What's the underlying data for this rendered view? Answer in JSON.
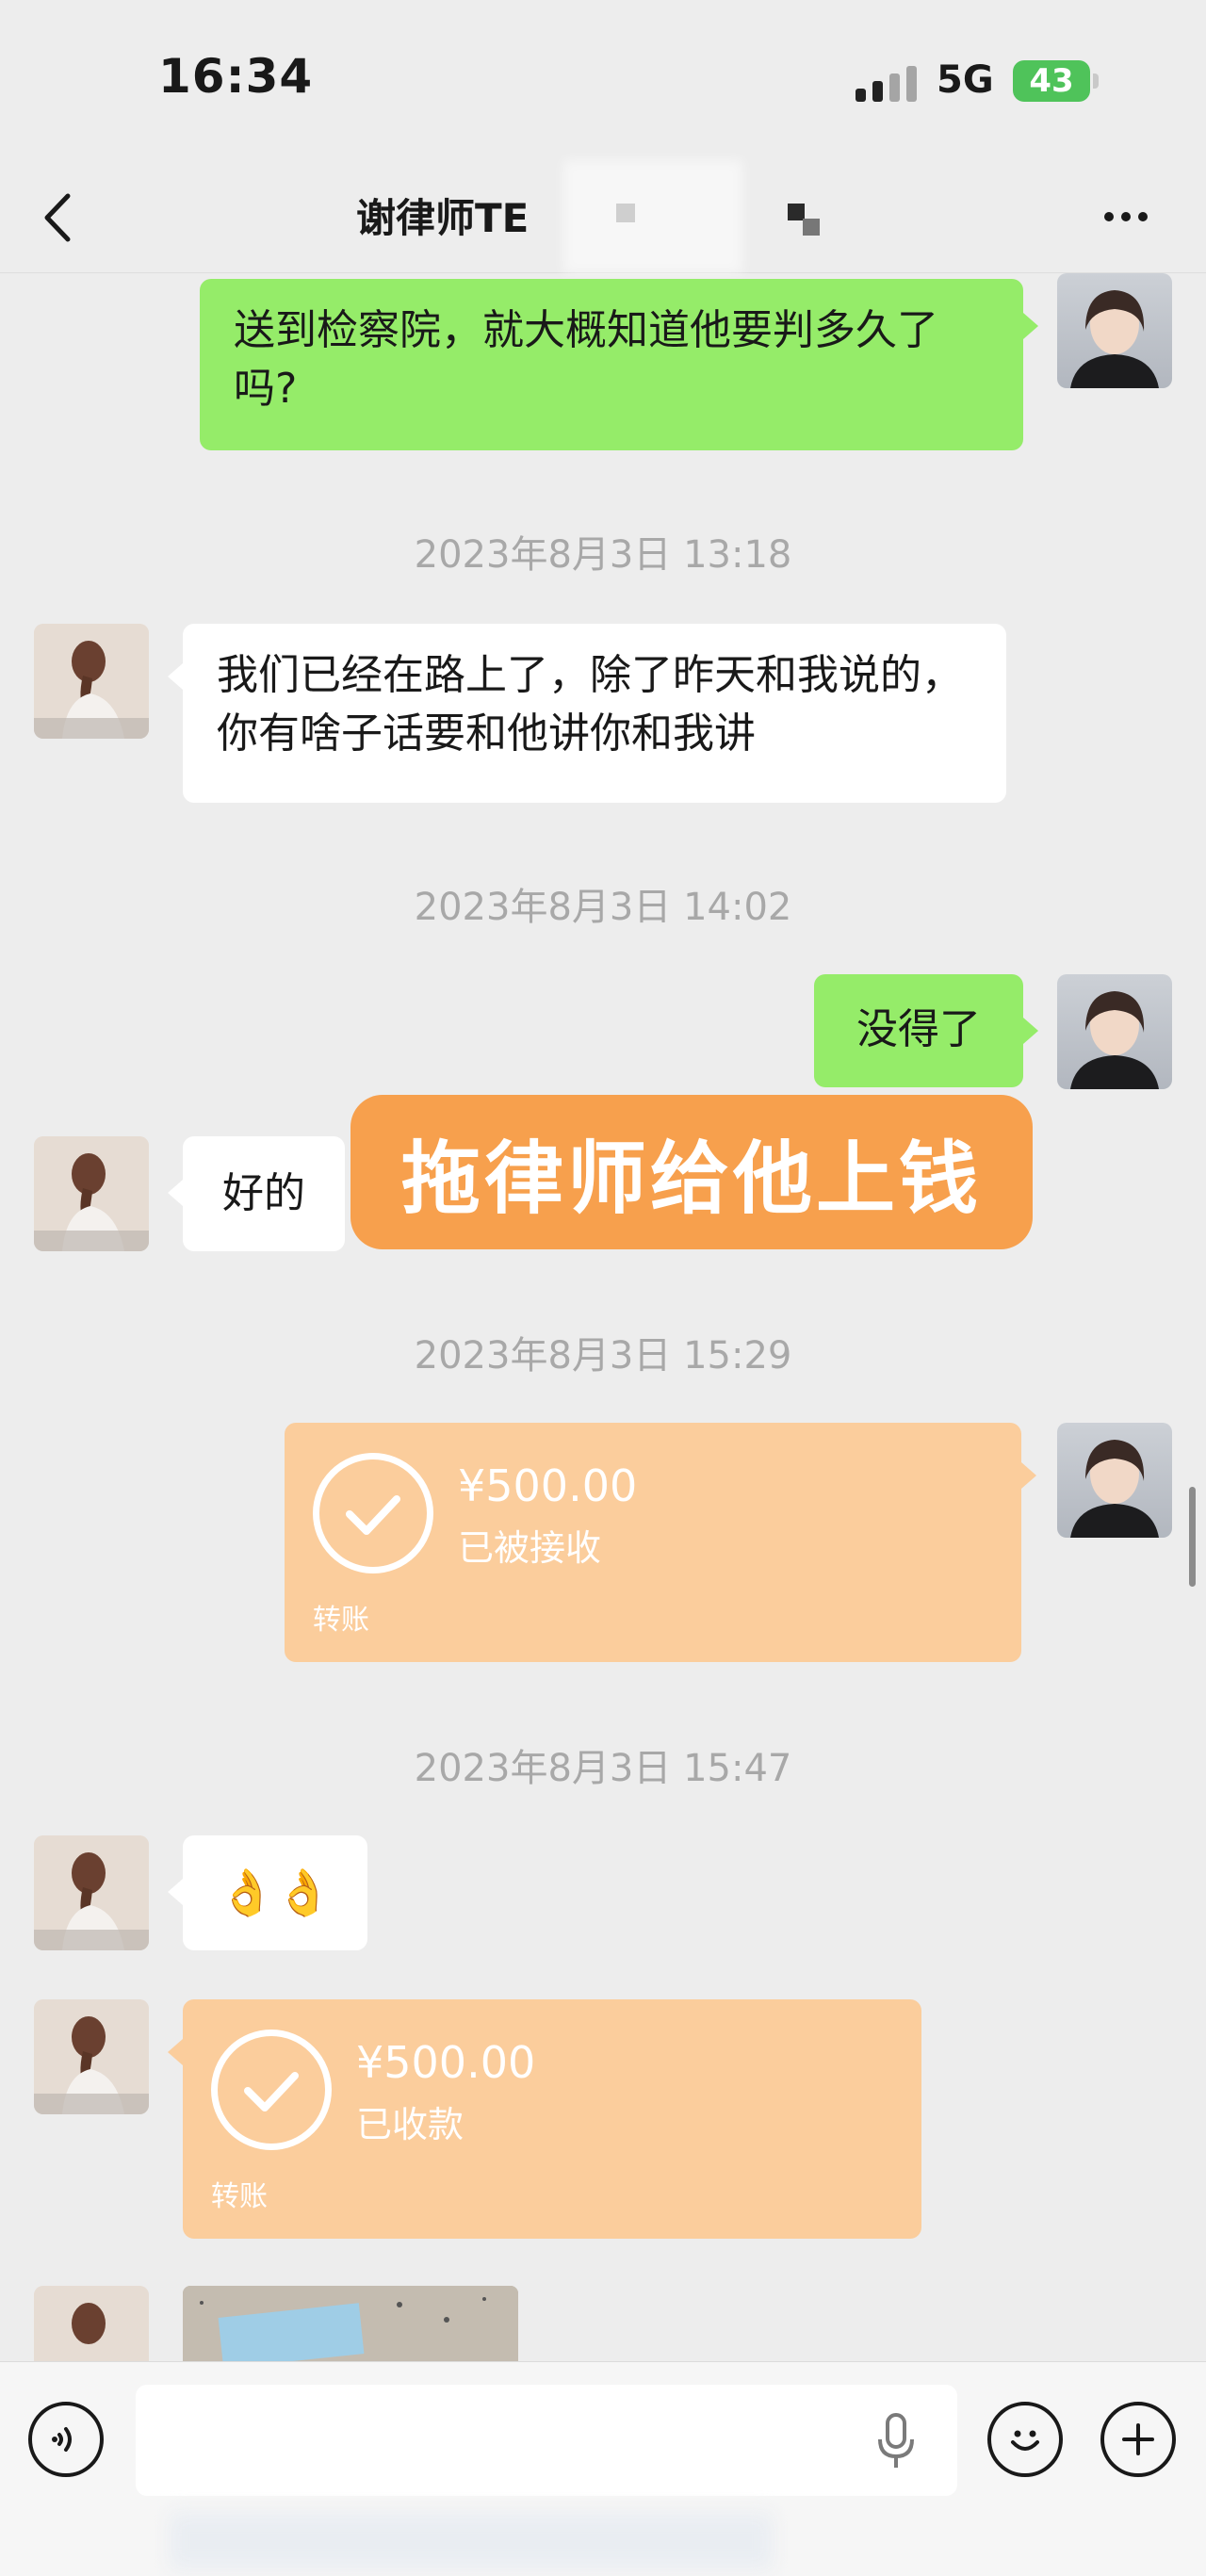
{
  "status_bar": {
    "time": "16:34",
    "network": "5G",
    "battery": "43"
  },
  "nav": {
    "title": "谢律师TE"
  },
  "messages": [
    {
      "type": "text",
      "side": "right",
      "text": "送到检察院，就大概知道他要判多久了吗?"
    },
    {
      "type": "time",
      "text": "2023年8月3日 13:18"
    },
    {
      "type": "text",
      "side": "left",
      "text": "我们已经在路上了，除了昨天和我说的，你有啥子话要和他讲你和我讲"
    },
    {
      "type": "time",
      "text": "2023年8月3日 14:02"
    },
    {
      "type": "text",
      "side": "right",
      "text": "没得了"
    },
    {
      "type": "text",
      "side": "left",
      "text": "好的"
    },
    {
      "type": "time",
      "text": "2023年8月3日 15:29"
    },
    {
      "type": "transfer",
      "side": "right",
      "amount": "¥500.00",
      "status": "已被接收",
      "label": "转账"
    },
    {
      "type": "time",
      "text": "2023年8月3日 15:47"
    },
    {
      "type": "emoji",
      "side": "left",
      "text": "👌👌"
    },
    {
      "type": "transfer",
      "side": "left",
      "amount": "¥500.00",
      "status": "已收款",
      "label": "转账"
    }
  ],
  "overlay": {
    "text": "拖律师给他上钱"
  },
  "input": {
    "placeholder": ""
  },
  "icons": {
    "back": "back-icon",
    "more": "more-icon",
    "voice": "voice-icon",
    "mic": "mic-icon",
    "emoji": "emoji-icon",
    "add": "add-icon",
    "check": "check-icon"
  },
  "colors": {
    "my_bubble": "#95ec69",
    "their_bubble": "#ffffff",
    "transfer": "#fbcd9c",
    "overlay": "#f7a04d",
    "background": "#ededed"
  }
}
